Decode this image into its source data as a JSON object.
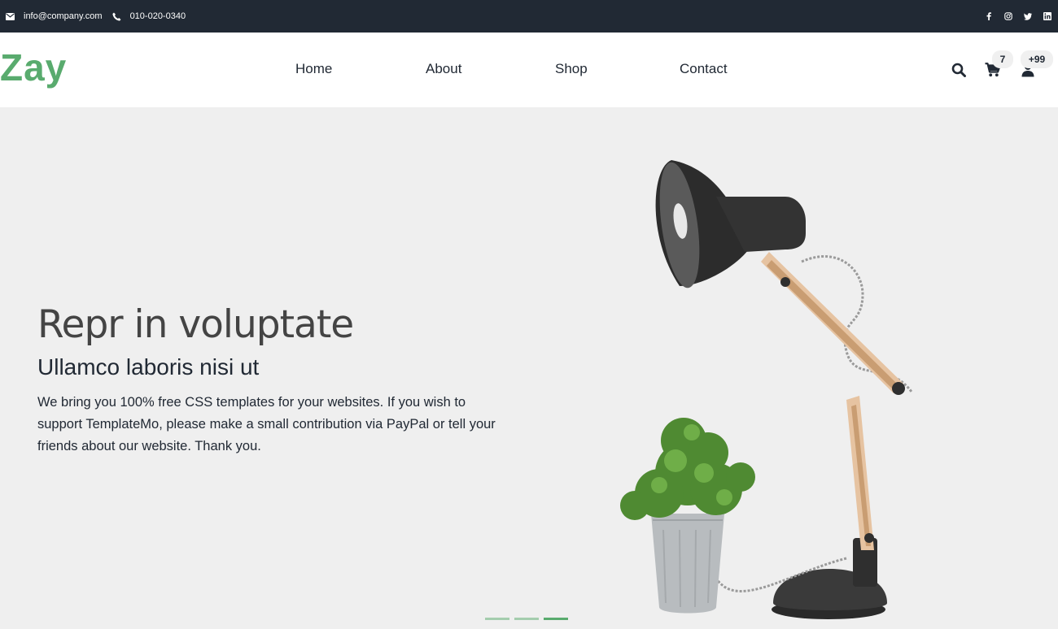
{
  "topbar": {
    "email": "info@company.com",
    "phone": "010-020-0340",
    "social": [
      "facebook-icon",
      "instagram-icon",
      "twitter-icon",
      "linkedin-icon"
    ]
  },
  "header": {
    "logo": "Zay",
    "nav": [
      "Home",
      "About",
      "Shop",
      "Contact"
    ],
    "cart_count": "7",
    "user_count": "+99"
  },
  "hero": {
    "title": "Repr in voluptate",
    "subtitle": "Ullamco laboris nisi ut",
    "text": "We bring you 100% free CSS templates for your websites. If you wish to support TemplateMo, please make a small contribution via PayPal or tell your friends about our website. Thank you.",
    "slides": 3,
    "active_slide": 3
  },
  "colors": {
    "brand": "#59ab6e",
    "dark": "#212934",
    "hero_bg": "#efefef"
  }
}
